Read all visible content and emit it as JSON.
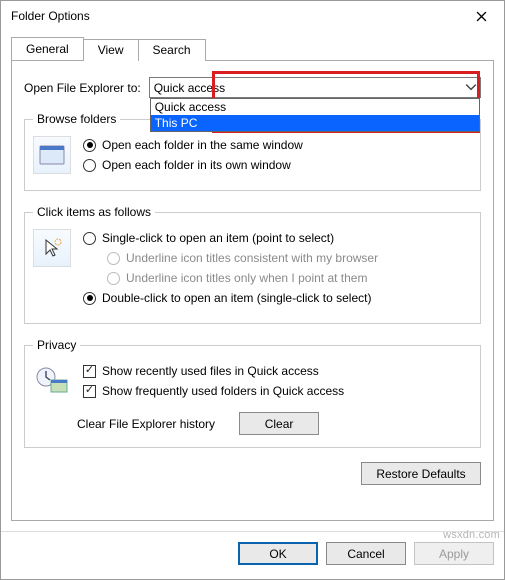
{
  "window": {
    "title": "Folder Options"
  },
  "tabs": {
    "general": "General",
    "view": "View",
    "search": "Search"
  },
  "open": {
    "label": "Open File Explorer to:",
    "selected": "Quick access",
    "options": [
      "Quick access",
      "This PC"
    ]
  },
  "browse": {
    "legend": "Browse folders",
    "same": "Open each folder in the same window",
    "own": "Open each folder in its own window"
  },
  "click": {
    "legend": "Click items as follows",
    "single": "Single-click to open an item (point to select)",
    "u_browser": "Underline icon titles consistent with my browser",
    "u_point": "Underline icon titles only when I point at them",
    "double": "Double-click to open an item (single-click to select)"
  },
  "privacy": {
    "legend": "Privacy",
    "recent": "Show recently used files in Quick access",
    "freq": "Show frequently used folders in Quick access",
    "clear_label": "Clear File Explorer history",
    "clear_btn": "Clear"
  },
  "buttons": {
    "restore": "Restore Defaults",
    "ok": "OK",
    "cancel": "Cancel",
    "apply": "Apply"
  },
  "watermark": "wsxdn.com"
}
